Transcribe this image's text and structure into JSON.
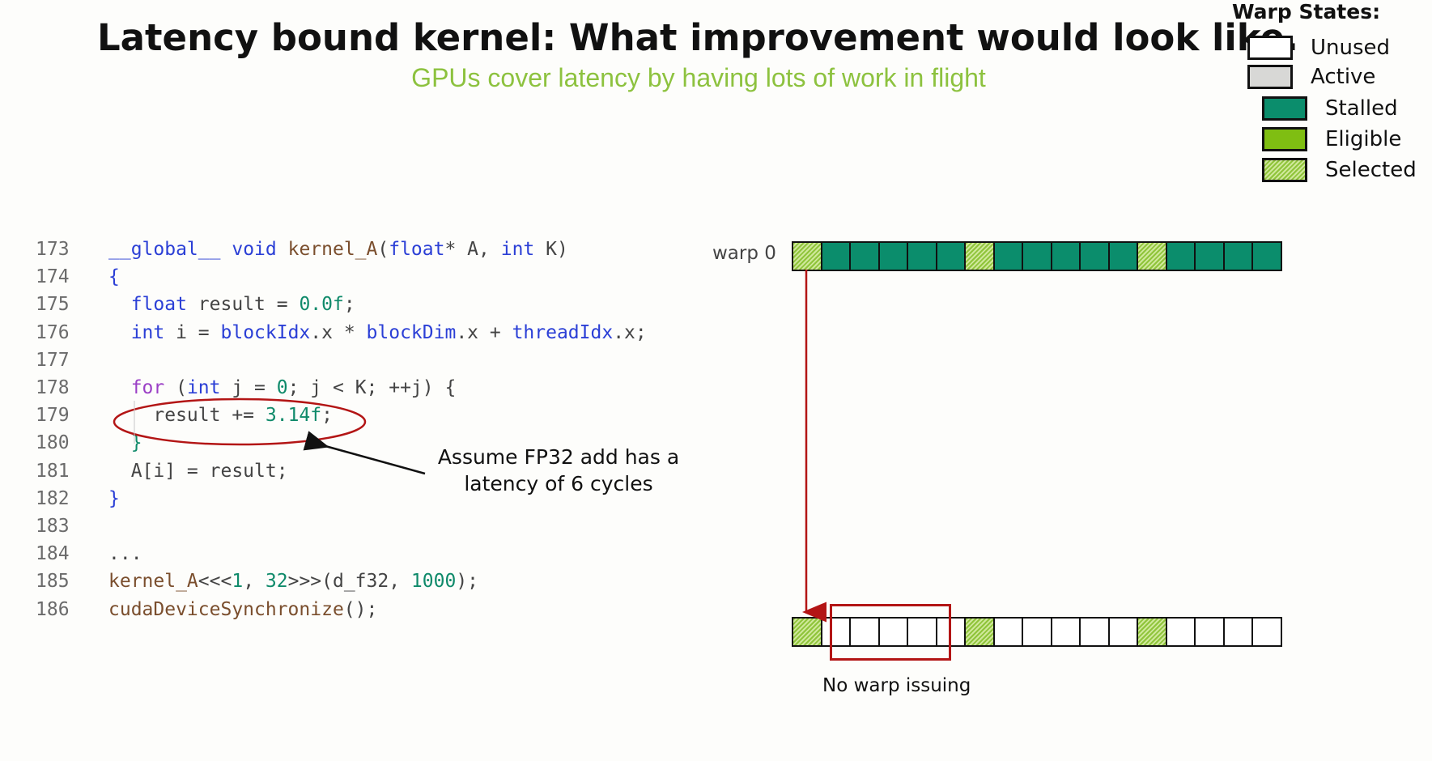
{
  "title": "Latency bound kernel: What improvement would look like.",
  "subtitle": "GPUs cover latency by having lots of work in flight",
  "legend": {
    "title": "Warp States:",
    "items": [
      {
        "label": "Unused",
        "state": "unused"
      },
      {
        "label": "Active",
        "state": "active"
      },
      {
        "label": "Stalled",
        "state": "stalled"
      },
      {
        "label": "Eligible",
        "state": "eligible"
      },
      {
        "label": "Selected",
        "state": "selected"
      }
    ]
  },
  "code": {
    "lines": [
      {
        "num": "173",
        "tokens": [
          {
            "t": "__global__",
            "c": "gl"
          },
          {
            "t": " ",
            "c": "pl"
          },
          {
            "t": "void",
            "c": "ty"
          },
          {
            "t": " ",
            "c": "pl"
          },
          {
            "t": "kernel_A",
            "c": "fn"
          },
          {
            "t": "(",
            "c": "pl"
          },
          {
            "t": "float",
            "c": "ty"
          },
          {
            "t": "* A, ",
            "c": "pl"
          },
          {
            "t": "int",
            "c": "ty"
          },
          {
            "t": " K)",
            "c": "pl"
          }
        ]
      },
      {
        "num": "174",
        "tokens": [
          {
            "t": "{",
            "c": "kw"
          }
        ]
      },
      {
        "num": "175",
        "tokens": [
          {
            "t": "  ",
            "c": "pl"
          },
          {
            "t": "float",
            "c": "ty"
          },
          {
            "t": " result = ",
            "c": "pl"
          },
          {
            "t": "0.0f",
            "c": "nm"
          },
          {
            "t": ";",
            "c": "pl"
          }
        ]
      },
      {
        "num": "176",
        "tokens": [
          {
            "t": "  ",
            "c": "pl"
          },
          {
            "t": "int",
            "c": "ty"
          },
          {
            "t": " i = ",
            "c": "pl"
          },
          {
            "t": "blockIdx",
            "c": "kw"
          },
          {
            "t": ".x * ",
            "c": "pl"
          },
          {
            "t": "blockDim",
            "c": "kw"
          },
          {
            "t": ".x + ",
            "c": "pl"
          },
          {
            "t": "threadIdx",
            "c": "kw"
          },
          {
            "t": ".x;",
            "c": "pl"
          }
        ]
      },
      {
        "num": "177",
        "tokens": []
      },
      {
        "num": "178",
        "tokens": [
          {
            "t": "  ",
            "c": "pl"
          },
          {
            "t": "for",
            "c": "ctl"
          },
          {
            "t": " (",
            "c": "pl"
          },
          {
            "t": "int",
            "c": "ty"
          },
          {
            "t": " j = ",
            "c": "pl"
          },
          {
            "t": "0",
            "c": "nm"
          },
          {
            "t": "; j < K; ++j) {",
            "c": "pl"
          }
        ]
      },
      {
        "num": "179",
        "tokens": [
          {
            "t": "    result += ",
            "c": "pl"
          },
          {
            "t": "3.14f",
            "c": "nm"
          },
          {
            "t": ";",
            "c": "pl"
          }
        ]
      },
      {
        "num": "180",
        "tokens": [
          {
            "t": "  }",
            "c": "nm"
          }
        ]
      },
      {
        "num": "181",
        "tokens": [
          {
            "t": "  A[i] = result;",
            "c": "pl"
          }
        ]
      },
      {
        "num": "182",
        "tokens": [
          {
            "t": "}",
            "c": "kw"
          }
        ]
      },
      {
        "num": "183",
        "tokens": []
      },
      {
        "num": "184",
        "tokens": [
          {
            "t": "...",
            "c": "pl"
          }
        ]
      },
      {
        "num": "185",
        "tokens": [
          {
            "t": "kernel_A",
            "c": "fn"
          },
          {
            "t": "<<<",
            "c": "pl"
          },
          {
            "t": "1",
            "c": "nm"
          },
          {
            "t": ", ",
            "c": "pl"
          },
          {
            "t": "32",
            "c": "nm"
          },
          {
            "t": ">>>(d_f32, ",
            "c": "pl"
          },
          {
            "t": "1000",
            "c": "nm"
          },
          {
            "t": ");",
            "c": "pl"
          }
        ]
      },
      {
        "num": "186",
        "tokens": [
          {
            "t": "cudaDeviceSynchronize",
            "c": "fn"
          },
          {
            "t": "();",
            "c": "pl"
          }
        ]
      }
    ]
  },
  "annotation": {
    "line1": "Assume FP32 add has a",
    "line2": "latency of 6 cycles"
  },
  "warp_label": "warp 0",
  "warp0_row": [
    "selected",
    "stalled",
    "stalled",
    "stalled",
    "stalled",
    "stalled",
    "selected",
    "stalled",
    "stalled",
    "stalled",
    "stalled",
    "stalled",
    "selected",
    "stalled",
    "stalled",
    "stalled",
    "stalled"
  ],
  "issue_row": [
    "selected",
    "unused",
    "unused",
    "unused",
    "unused",
    "unused",
    "selected",
    "unused",
    "unused",
    "unused",
    "unused",
    "unused",
    "selected",
    "unused",
    "unused",
    "unused",
    "unused"
  ],
  "no_issue_label": "No warp issuing",
  "colors": {
    "stalled": "#0b8d6c",
    "eligible": "#7fbe12",
    "active": "#d8d8d6",
    "unused": "#ffffff",
    "highlight": "#b31515",
    "subtitle": "#8dc23f"
  }
}
